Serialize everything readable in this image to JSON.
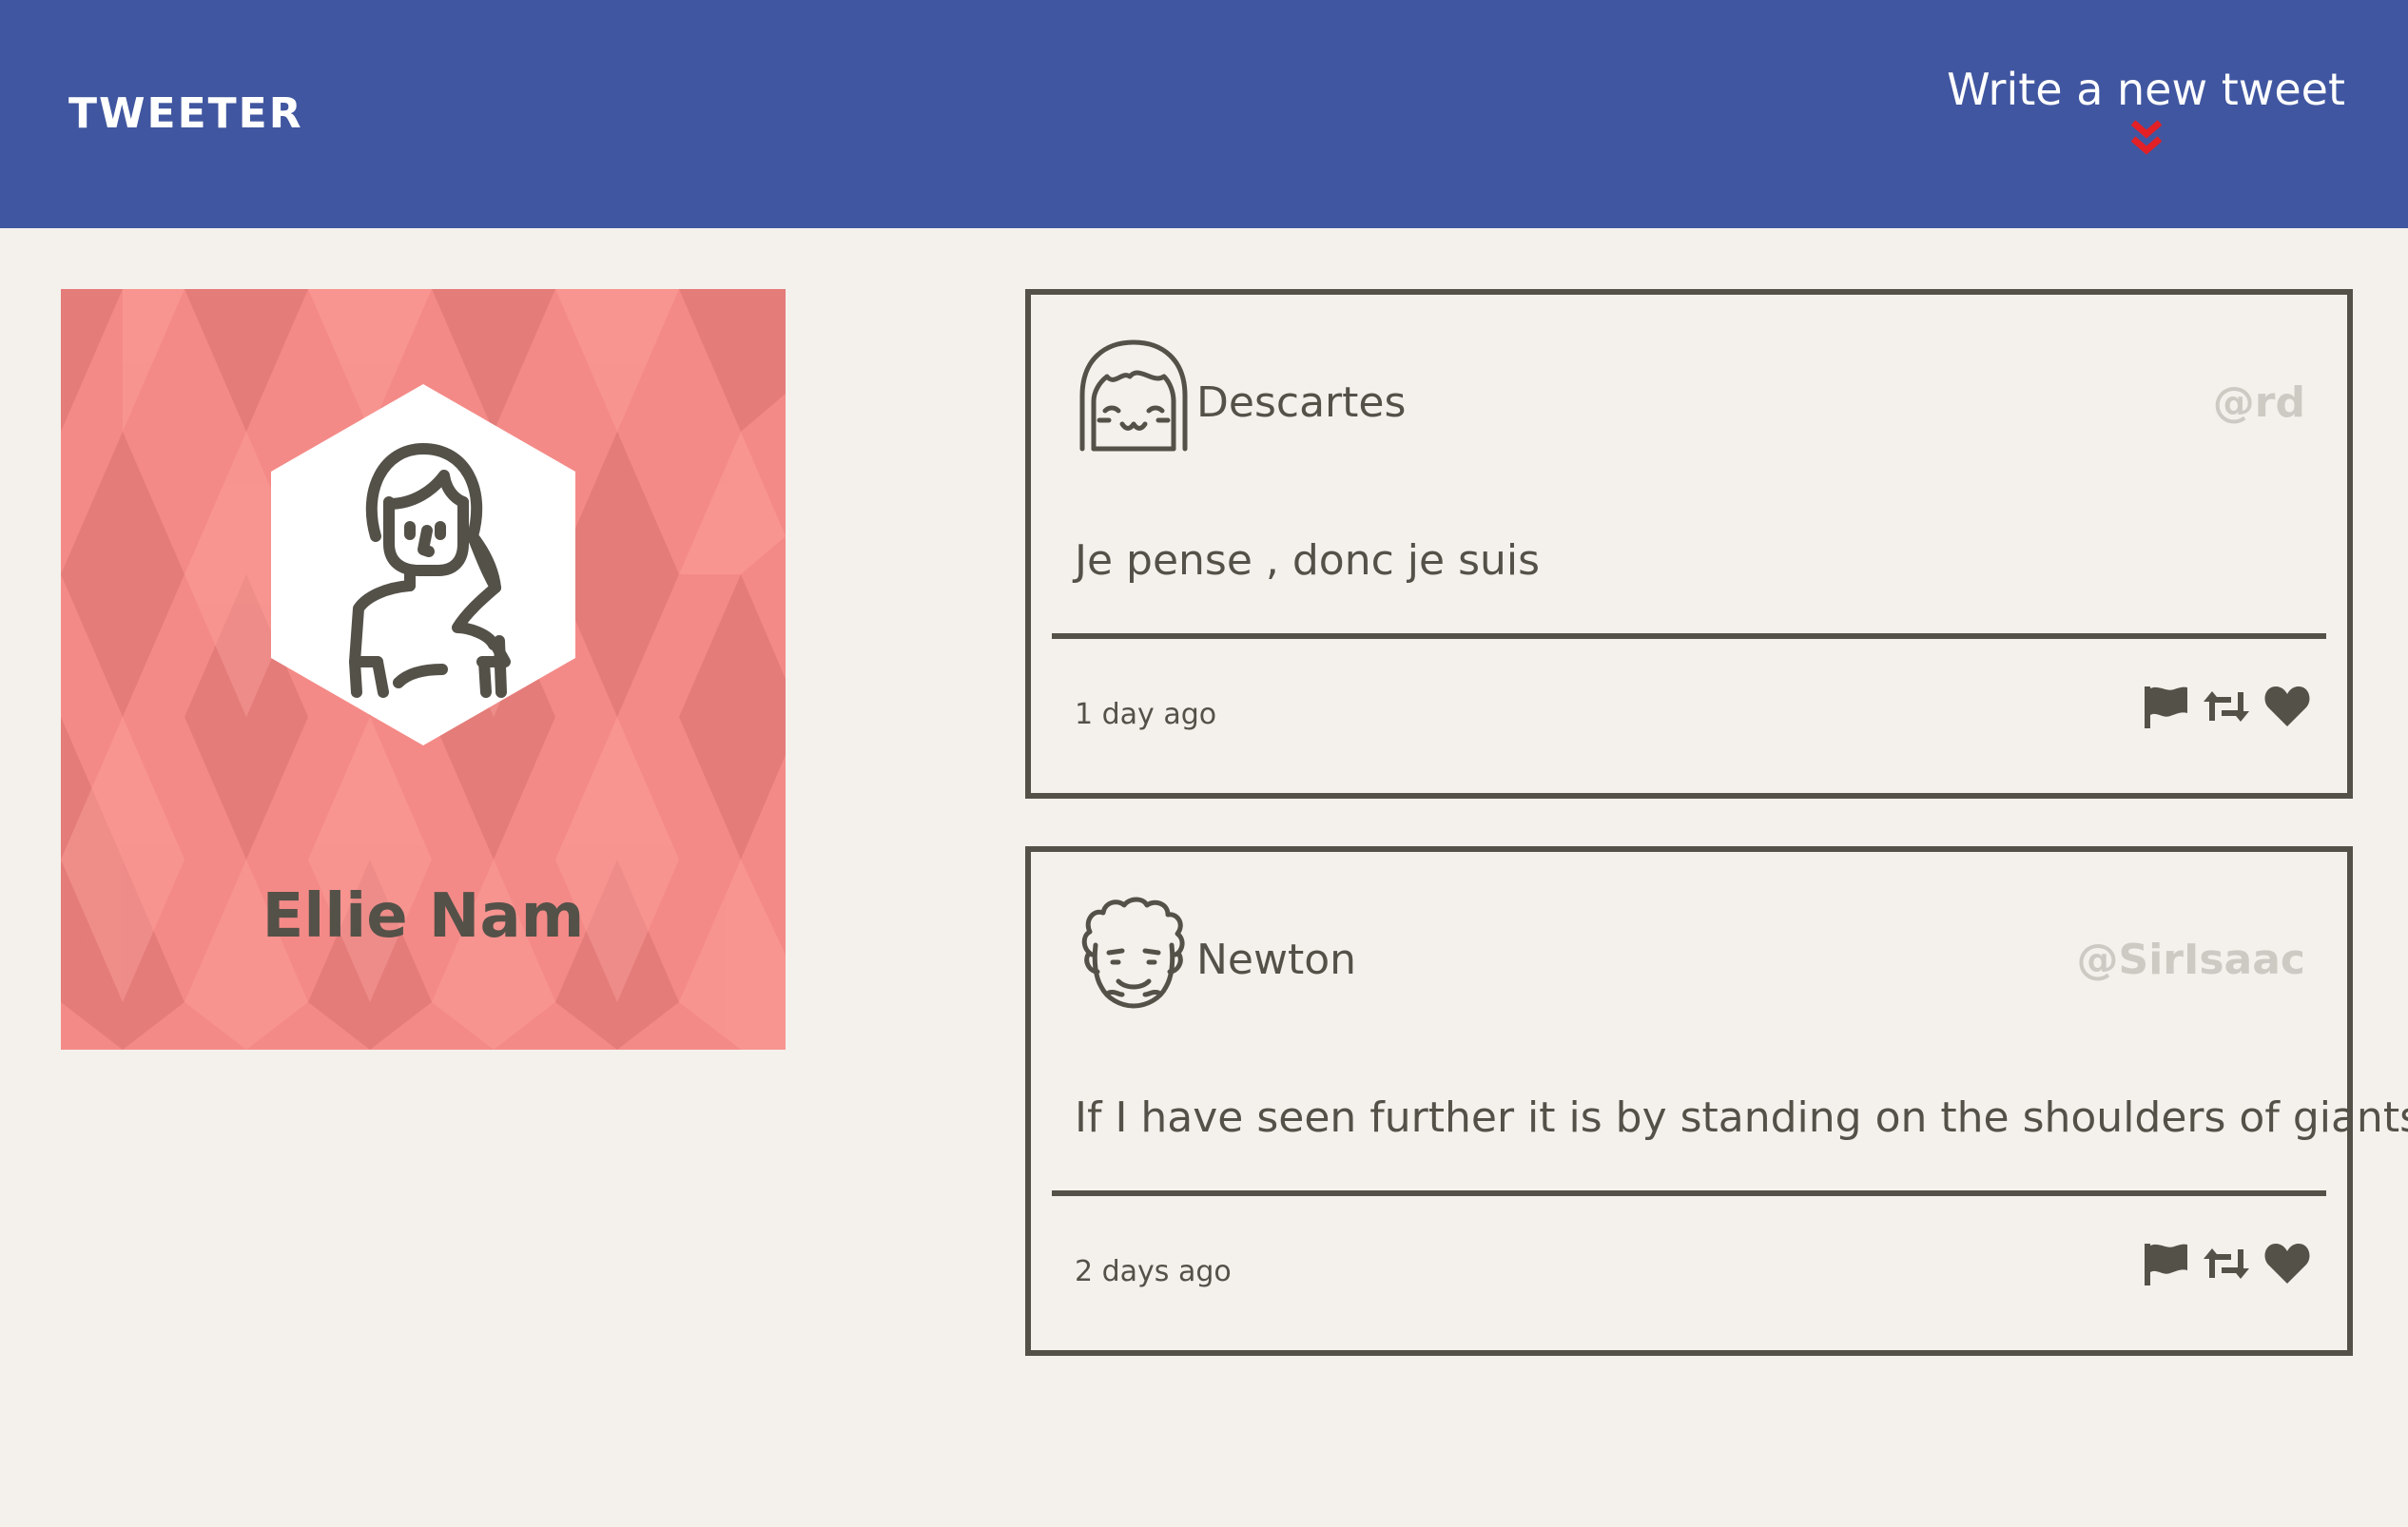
{
  "nav": {
    "brand": "TWEETER",
    "compose_label": "Write a new tweet",
    "compose_arrow_icon": "double-chevron-down-icon",
    "colors": {
      "background": "#4056a0",
      "arrow": "#e32026"
    }
  },
  "profile": {
    "name": "Ellie Nam",
    "avatar_icon": "woman-avatar-icon",
    "colors": {
      "background": "#f48a87"
    }
  },
  "tweets": [
    {
      "user": "Descartes",
      "handle": "@rd",
      "text": "Je pense , donc je suis",
      "time": "1 day ago",
      "avatar_icon": "girl-avatar-icon",
      "actions": [
        "flag-icon",
        "retweet-icon",
        "heart-icon"
      ]
    },
    {
      "user": "Newton",
      "handle": "@SirIsaac",
      "text": "If I have seen further it is by standing on the shoulders of giants",
      "time": "2 days ago",
      "avatar_icon": "curly-man-avatar-icon",
      "actions": [
        "flag-icon",
        "retweet-icon",
        "heart-icon"
      ]
    }
  ],
  "colors": {
    "page_background": "#f4f1ec",
    "ink": "#545149",
    "handle": "#cdcac3"
  }
}
